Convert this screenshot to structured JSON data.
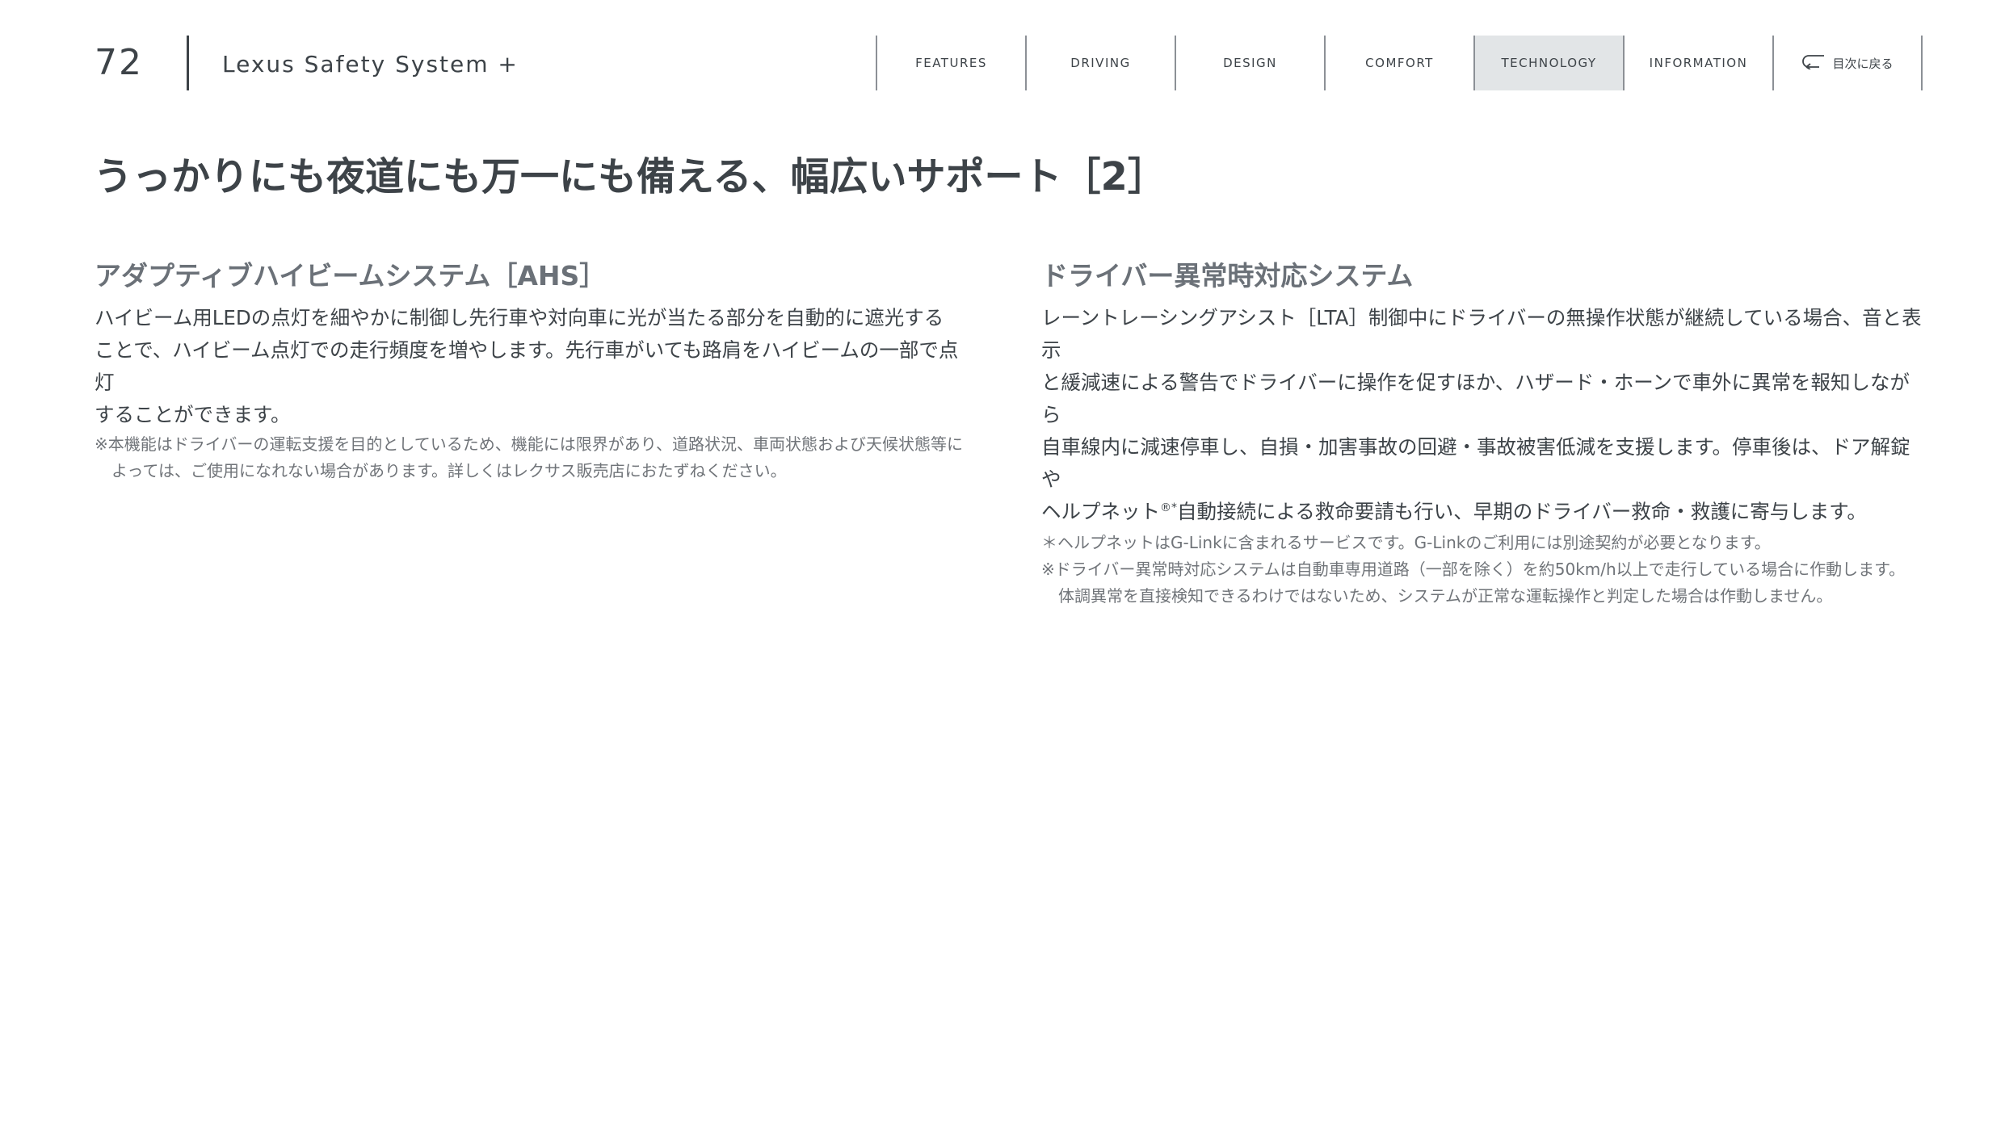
{
  "header": {
    "page_number": "72",
    "section_name": "Lexus Safety System +",
    "nav_tabs": [
      {
        "label": "FEATURES",
        "active": false
      },
      {
        "label": "DRIVING",
        "active": false
      },
      {
        "label": "DESIGN",
        "active": false
      },
      {
        "label": "COMFORT",
        "active": false
      },
      {
        "label": "TECHNOLOGY",
        "active": true
      },
      {
        "label": "INFORMATION",
        "active": false
      }
    ],
    "back_label": "目次に戻る",
    "back_icon": "return-arrow-icon"
  },
  "page_title": "うっかりにも夜道にも万一にも備える、幅広いサポート［2］",
  "left_column": {
    "heading": "アダプティブハイビームシステム［AHS］",
    "body_lines": [
      "ハイビーム用LEDの点灯を細やかに制御し先行車や対向車に光が当たる部分を自動的に遮光する",
      "ことで、ハイビーム点灯での走行頻度を増やします。先行車がいても路肩をハイビームの一部で点灯",
      "することができます。"
    ],
    "note_line1": "※本機能はドライバーの運転支援を目的としているため、機能には限界があり、道路状況、車両状態および天候状態等に",
    "note_line2": "よっては、ご使用になれない場合があります。詳しくはレクサス販売店におたずねください。"
  },
  "right_column": {
    "heading": "ドライバー異常時対応システム",
    "body_lines": [
      "レーントレーシングアシスト［LTA］制御中にドライバーの無操作状態が継続している場合、音と表示",
      "と緩減速による警告でドライバーに操作を促すほか、ハザード・ホーンで車外に異常を報知しながら",
      "自車線内に減速停車し、自損・加害事故の回避・事故被害低減を支援します。停車後は、ドア解錠や"
    ],
    "body_line4_pre": "ヘルプネット",
    "body_line4_sup": "®*",
    "body_line4_post": "自動接続による救命要請も行い、早期のドライバー救命・救護に寄与します。",
    "notes": [
      "＊ヘルプネットはG-Linkに含まれるサービスです。G-Linkのご利用には別途契約が必要となります。",
      "※ドライバー異常時対応システムは自動車専用道路（一部を除く）を約50km/h以上で走行している場合に作動します。"
    ],
    "note_indent": "体調異常を直接検知できるわけではないため、システムが正常な運転操作と判定した場合は作動しません。"
  }
}
